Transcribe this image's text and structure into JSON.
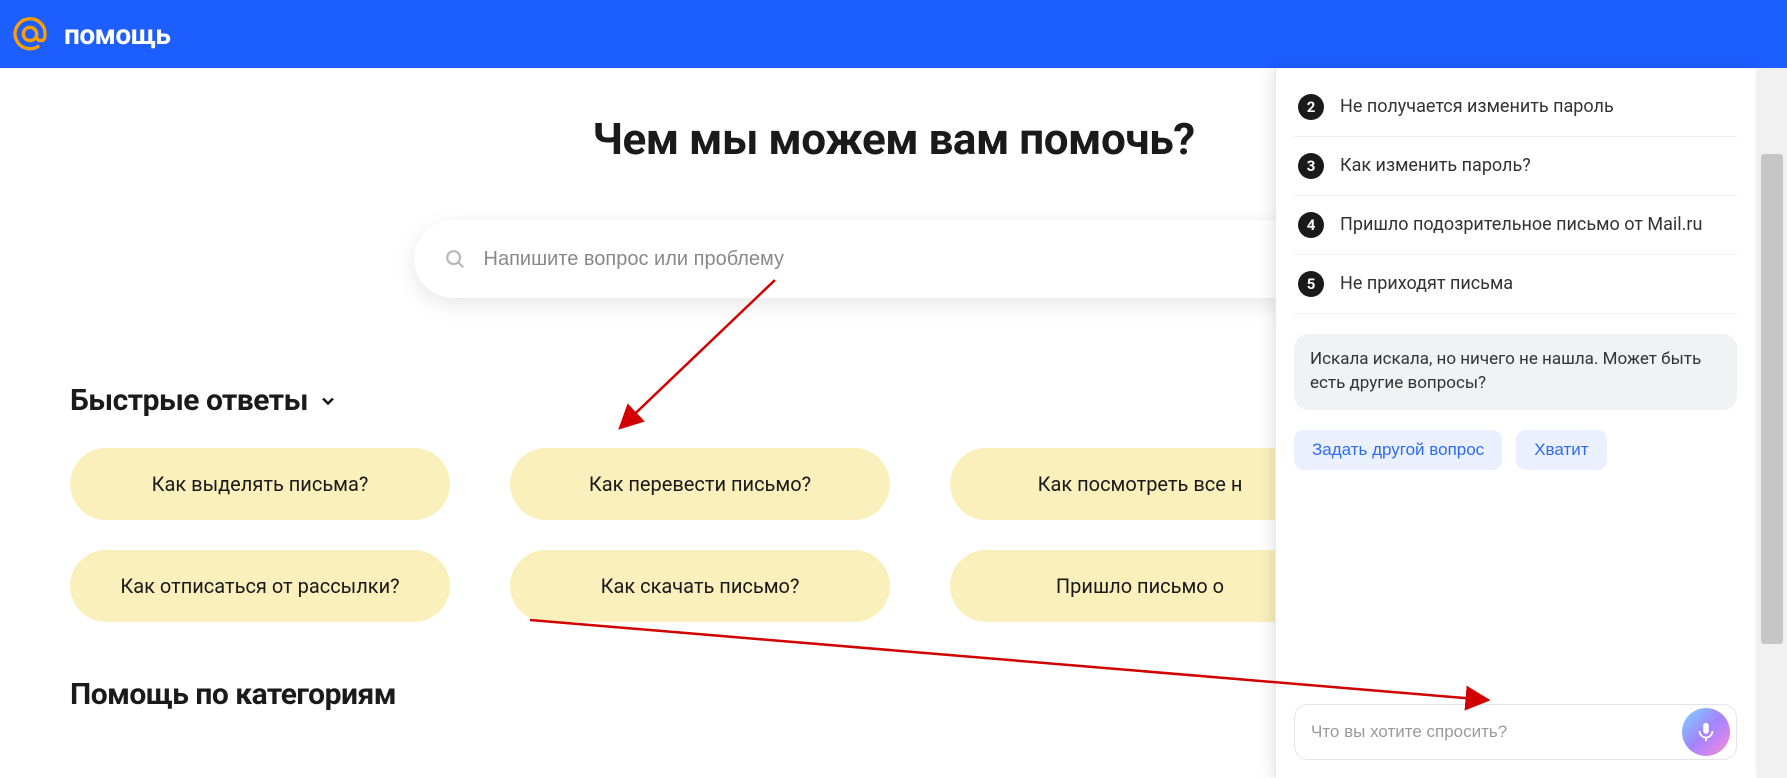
{
  "header": {
    "brand": "помощь"
  },
  "main": {
    "title": "Чем мы можем вам помочь?",
    "search_placeholder": "Напишите вопрос или проблему",
    "quick_answers_title": "Быстрые ответы",
    "chips": [
      "Как выделять письма?",
      "Как перевести письмо?",
      "Как посмотреть все н",
      "Как отписаться от рассылки?",
      "Как скачать письмо?",
      "Пришло письмо о"
    ],
    "categories_title": "Помощь по категориям"
  },
  "chat": {
    "items": [
      {
        "num": "2",
        "text": "Не получается изменить пароль"
      },
      {
        "num": "3",
        "text": "Как изменить пароль?"
      },
      {
        "num": "4",
        "text": "Пришло подозрительное письмо от Mail.ru"
      },
      {
        "num": "5",
        "text": "Не приходят письма"
      }
    ],
    "bubble": "Искала искала, но ничего не нашла. Может быть есть другие вопросы?",
    "actions": {
      "another": "Задать другой вопрос",
      "stop": "Хватит"
    },
    "input_placeholder": "Что вы хотите спросить?"
  }
}
